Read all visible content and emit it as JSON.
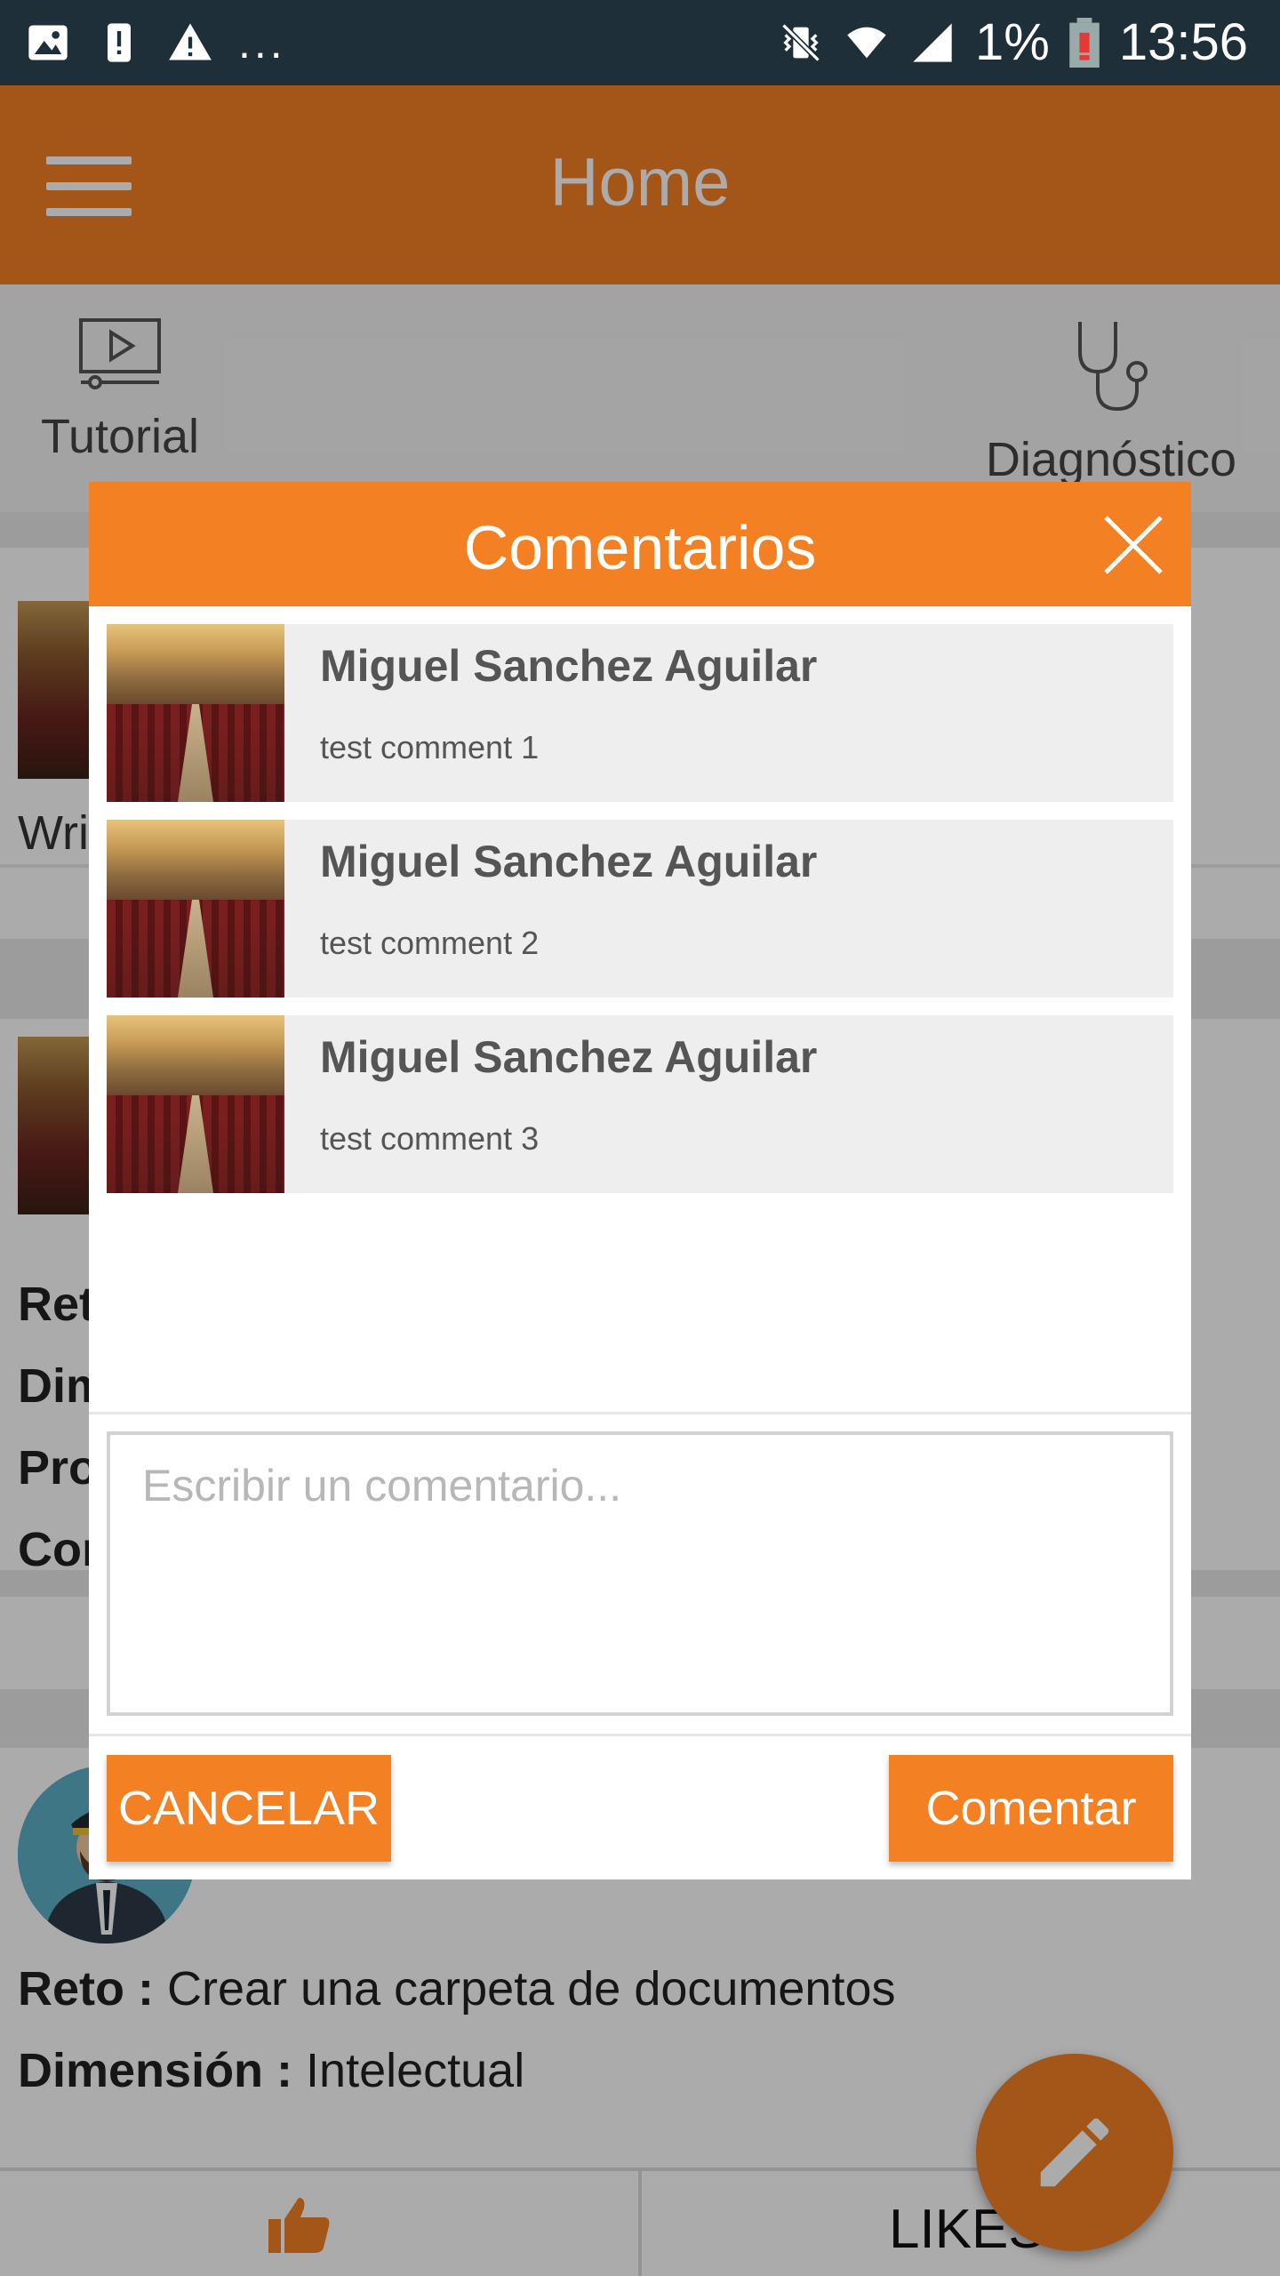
{
  "status_bar": {
    "battery_percent": "1%",
    "time": "13:56",
    "overflow": "...",
    "icons": [
      "image-icon",
      "alert-icon",
      "warning-icon",
      "vibrate-off-icon",
      "wifi-icon",
      "signal-icon",
      "battery-low-icon"
    ]
  },
  "toolbar": {
    "title": "Home",
    "menu_icon": "hamburger-icon"
  },
  "quick_actions": [
    {
      "label": "Tutorial",
      "icon": "video-tutorial-icon"
    },
    {
      "label": "Diagnóstico",
      "icon": "stethoscope-icon"
    }
  ],
  "feed": {
    "card1_truncated_text": "Wri",
    "card2_truncated_lines": [
      "Ret",
      "Dim",
      "Pro",
      "Cor"
    ],
    "card3": {
      "reto_label": "Reto :",
      "reto_value": "Crear una carpeta de documentos",
      "dimension_label": "Dimensión :",
      "dimension_value": "Intelectual"
    },
    "likes_label": "LIKES"
  },
  "dialog": {
    "title": "Comentarios",
    "comments": [
      {
        "author": "Miguel Sanchez Aguilar",
        "text": "test comment 1"
      },
      {
        "author": "Miguel Sanchez Aguilar",
        "text": "test comment 2"
      },
      {
        "author": "Miguel Sanchez Aguilar",
        "text": "test comment 3"
      }
    ],
    "input_placeholder": "Escribir un comentario...",
    "input_value": "",
    "cancel_label": "CANCELAR",
    "submit_label": "Comentar"
  },
  "colors": {
    "accent": "#f48024",
    "status_bar": "#1e2f3a",
    "scrim": "rgba(0,0,0,0.33)",
    "comment_bg": "#eeeeee"
  }
}
